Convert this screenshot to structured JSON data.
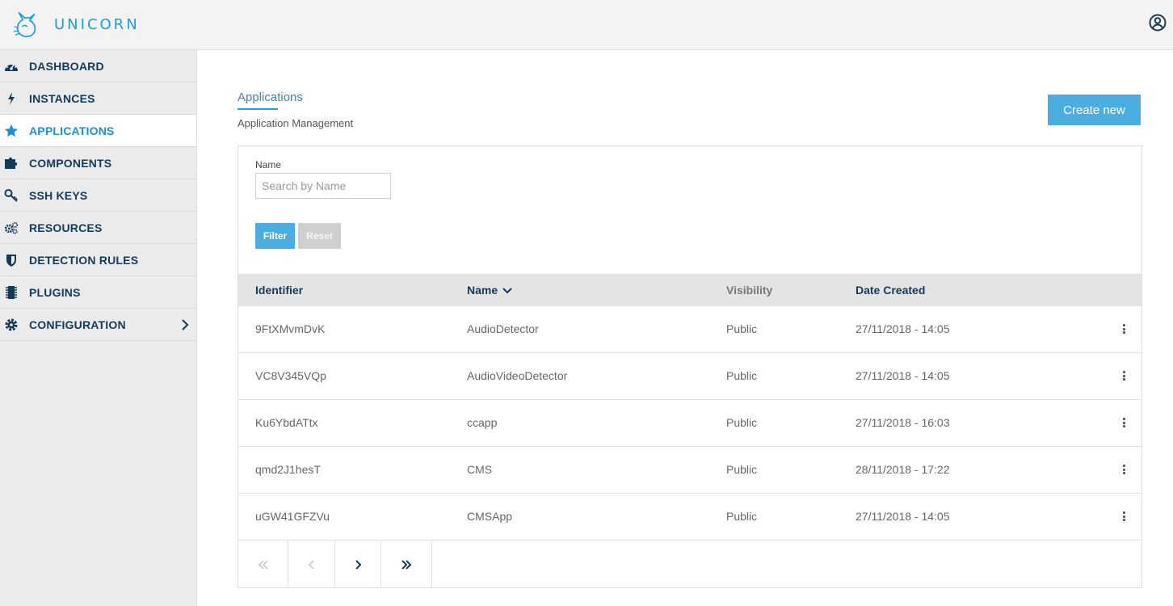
{
  "app": {
    "brand": "UNICORN",
    "accent": "#1e9fd6"
  },
  "sidebar": {
    "items": [
      {
        "label": "DASHBOARD",
        "icon": "dashboard-icon"
      },
      {
        "label": "INSTANCES",
        "icon": "bolt-icon"
      },
      {
        "label": "APPLICATIONS",
        "icon": "star-icon",
        "active": true
      },
      {
        "label": "COMPONENTS",
        "icon": "puzzle-icon"
      },
      {
        "label": "SSH KEYS",
        "icon": "key-icon"
      },
      {
        "label": "RESOURCES",
        "icon": "gears-icon"
      },
      {
        "label": "DETECTION RULES",
        "icon": "shield-icon"
      },
      {
        "label": "PLUGINS",
        "icon": "chip-icon"
      },
      {
        "label": "CONFIGURATION",
        "icon": "gear-icon",
        "expandable": true
      }
    ]
  },
  "page": {
    "title": "Applications",
    "subtitle": "Application Management",
    "create_label": "Create new"
  },
  "filter": {
    "label": "Name",
    "placeholder": "Search by Name",
    "value": "",
    "filter_label": "Filter",
    "reset_label": "Reset"
  },
  "table": {
    "headers": {
      "identifier": "Identifier",
      "name": "Name",
      "visibility": "Visibility",
      "date_created": "Date Created"
    },
    "rows": [
      {
        "identifier": "9FtXMvmDvK",
        "name": "AudioDetector",
        "visibility": "Public",
        "date_created": "27/11/2018 - 14:05"
      },
      {
        "identifier": "VC8V345VQp",
        "name": "AudioVideoDetector",
        "visibility": "Public",
        "date_created": "27/11/2018 - 14:05"
      },
      {
        "identifier": "Ku6YbdATtx",
        "name": "ccapp",
        "visibility": "Public",
        "date_created": "27/11/2018 - 16:03"
      },
      {
        "identifier": "qmd2J1hesT",
        "name": "CMS",
        "visibility": "Public",
        "date_created": "28/11/2018 - 17:22"
      },
      {
        "identifier": "uGW41GFZVu",
        "name": "CMSApp",
        "visibility": "Public",
        "date_created": "27/11/2018 - 14:05"
      }
    ]
  }
}
